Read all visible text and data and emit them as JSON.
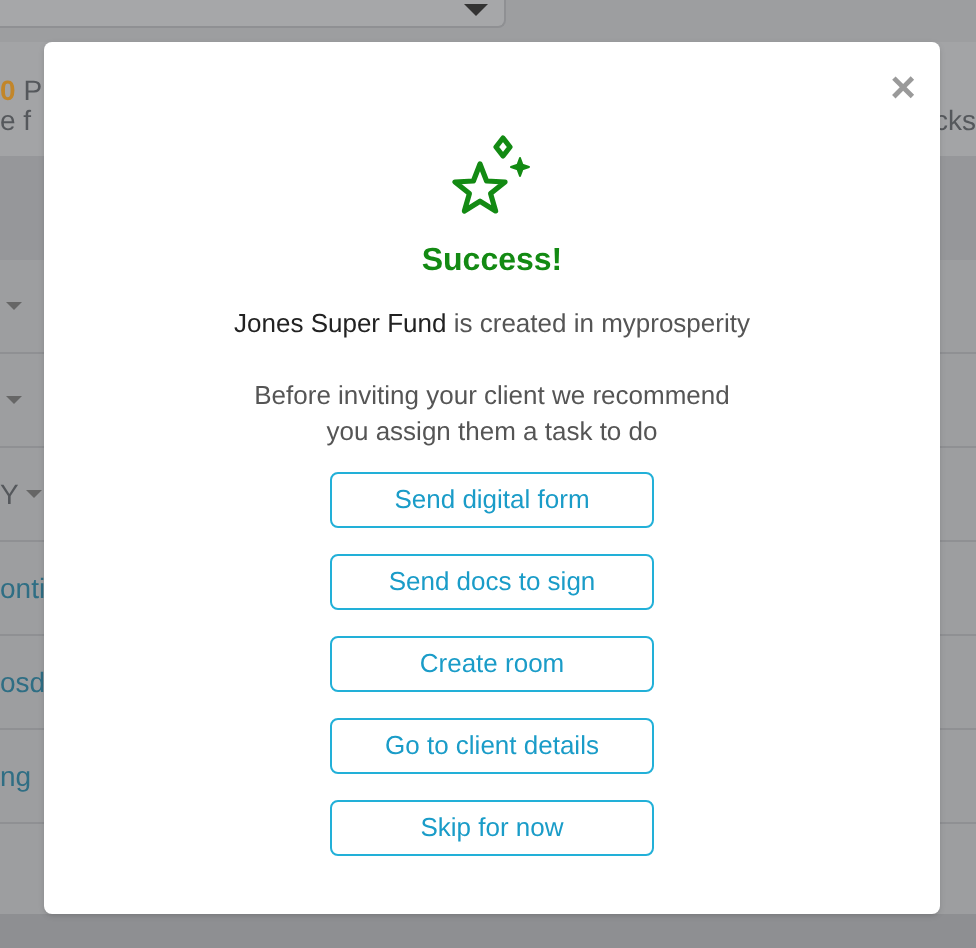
{
  "background": {
    "banner_lines": [
      {
        "text": "0",
        "kind": "highlight"
      },
      {
        "text": "P",
        "kind": "plain"
      }
    ],
    "banner_line_2": "e f",
    "banner_right": "cks",
    "rows": [
      {
        "text": "",
        "kind": "dropdown"
      },
      {
        "text": "",
        "kind": "dropdown"
      },
      {
        "text": "Y",
        "kind": "dropdown"
      },
      {
        "text": "onti",
        "kind": "link"
      },
      {
        "text": "osd",
        "kind": "link"
      },
      {
        "text": "ng",
        "kind": "link"
      }
    ]
  },
  "dialog": {
    "close": "×",
    "title": "Success!",
    "message": "**Jones Super Fund** is created in myprosperity",
    "hint": "Before inviting your client we recommend you assign them a task to do",
    "buttons": [
      "Send digital form",
      "Send docs to sign",
      "Create room",
      "Go to client details",
      "Skip for now"
    ]
  }
}
